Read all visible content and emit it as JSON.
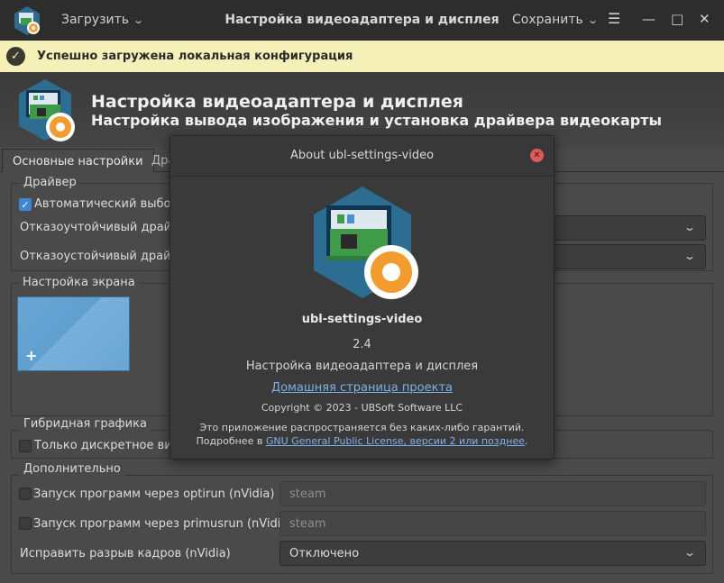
{
  "window": {
    "load_label": "Загрузить",
    "title": "Настройка видеоадаптера и дисплея",
    "save_label": "Сохранить",
    "menu_icon": "hamburger-icon",
    "minimize_icon": "minimize-icon",
    "maximize_icon": "maximize-icon",
    "close_icon": "close-icon"
  },
  "infobar": {
    "message": "Успешно загружена локальная конфигурация",
    "icon": "check-circle-icon",
    "color": "#f4f0b8"
  },
  "banner": {
    "title": "Настройка видеоадаптера и дисплея",
    "subtitle": "Настройка вывода изображения и установка драйвера видеокарты"
  },
  "tabs": [
    {
      "label": "Основные настройки",
      "active": true
    },
    {
      "label": "Драйверы",
      "visible_text": "Дра"
    }
  ],
  "driver": {
    "group_label": "Драйвер",
    "auto_select_label": "Автоматический выбор",
    "auto_select_checked": true,
    "failsafe1_label": "Отказоучтойчивый драйве",
    "failsafe2_label": "Отказоустойчивый драйве"
  },
  "screen": {
    "group_label": "Настройка экрана",
    "add_monitor": "+"
  },
  "hybrid": {
    "group_label": "Гибридная графика",
    "discrete_only_label": "Только дискретное виде",
    "discrete_only_checked": false
  },
  "additional": {
    "group_label": "Дополнительно",
    "optirun_label": "Запуск программ через optirun (nVidia)",
    "optirun_placeholder": "steam",
    "primusrun_label": "Запуск программ через primusrun (nVidia)",
    "primusrun_placeholder": "steam",
    "tearing_label": "Исправить разрыв кадров (nVidia)",
    "tearing_value": "Отключено"
  },
  "about": {
    "title": "About ubl-settings-video",
    "app_name": "ubl-settings-video",
    "version": "2.4",
    "description": "Настройка видеоадаптера и дисплея",
    "homepage_link": "Домашняя страница проекта",
    "copyright": "Copyright © 2023 - UBSoft Software LLC",
    "warranty": "Это приложение распространяется без каких-либо гарантий.",
    "more_prefix": "Подробнее в ",
    "license_link": "GNU General Public License, версии 2 или позднее",
    "more_suffix": "."
  }
}
